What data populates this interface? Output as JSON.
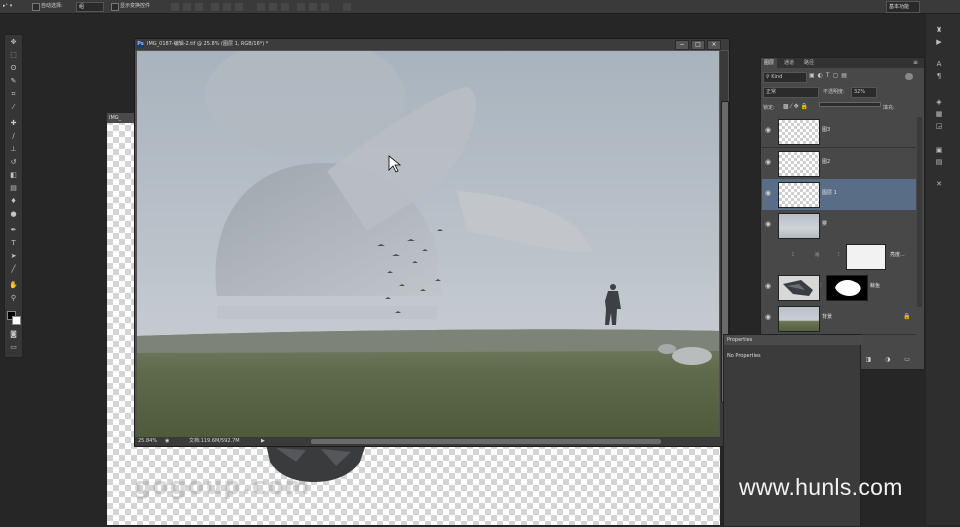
{
  "option_bar": {
    "auto_select_label": "自动选择:",
    "auto_select_value": "组",
    "show_transform_label": "显示变换控件",
    "workspace": "基本功能"
  },
  "tools": [
    "move",
    "marquee",
    "lasso",
    "quick-select",
    "crop",
    "eyedropper",
    "healing",
    "brush",
    "clone",
    "history",
    "eraser",
    "gradient",
    "blur",
    "dodge",
    "pen",
    "type",
    "path-select",
    "shape",
    "hand",
    "zoom"
  ],
  "document": {
    "title": "IMG_0187-编辑-2.tif @ 25.8% (图层 1, RGB/16*) *",
    "zoom": "25.84%",
    "doc_size": "文档:119.6M/592.7M",
    "icon_label": "Ps"
  },
  "bg_document": {
    "tab": "IMG_"
  },
  "layers_panel": {
    "tabs": [
      "图层",
      "通道",
      "路径"
    ],
    "filter_kind": "Kind",
    "blend_mode": "正常",
    "opacity_label": "不透明度:",
    "opacity_value": "32%",
    "lock_label": "锁定:",
    "fill_label": "填充:",
    "layers": [
      {
        "name": "图3",
        "selected": false,
        "thumb": "transparent"
      },
      {
        "name": "图2",
        "selected": false,
        "thumb": "transparent"
      },
      {
        "name": "图层 1",
        "selected": true,
        "thumb": "transparent"
      },
      {
        "name": "雾",
        "selected": false,
        "thumb": "fog"
      },
      {
        "name": "亮度...",
        "selected": false,
        "thumb": "adjustment"
      },
      {
        "name": "鲸鱼",
        "selected": false,
        "thumb": "whale"
      },
      {
        "name": "背景",
        "selected": false,
        "thumb": "landscape"
      }
    ]
  },
  "properties_panel": {
    "title": "Properties",
    "empty_text": "No Properties"
  },
  "watermarks": {
    "left": "gogoup.com",
    "right": "www.hunls.com"
  },
  "colors": {
    "selected_layer": "#596d86",
    "fog_sky": "#b3bcc4",
    "grass": "#5b6648"
  }
}
